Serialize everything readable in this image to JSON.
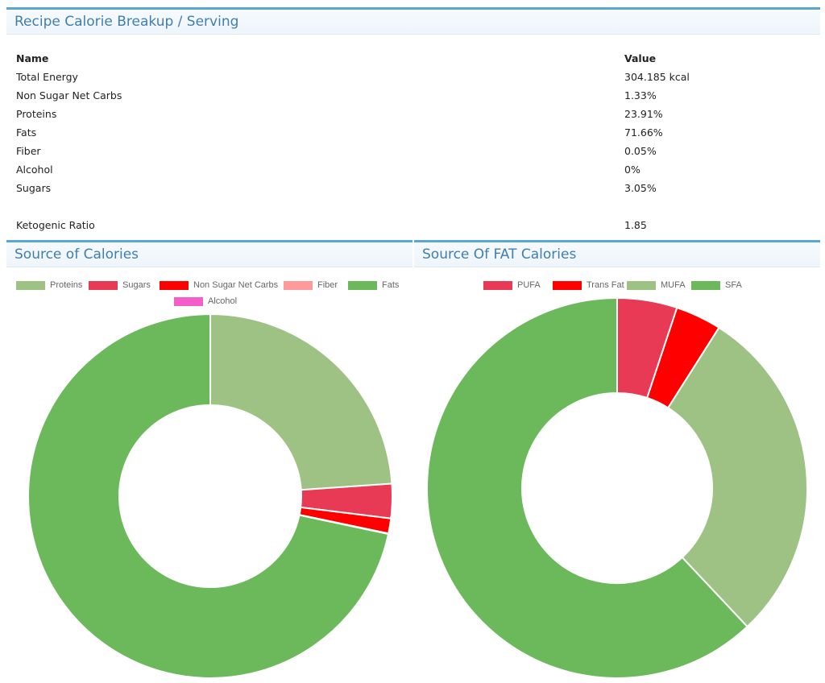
{
  "breakup": {
    "title": "Recipe Calorie Breakup / Serving",
    "headers": {
      "name": "Name",
      "value": "Value"
    },
    "rows": [
      {
        "name": "Total Energy",
        "value": "304.185 kcal"
      },
      {
        "name": "Non Sugar Net Carbs",
        "value": "1.33%"
      },
      {
        "name": "Proteins",
        "value": "23.91%"
      },
      {
        "name": "Fats",
        "value": "71.66%"
      },
      {
        "name": "Fiber",
        "value": "0.05%"
      },
      {
        "name": "Alcohol",
        "value": "0%"
      },
      {
        "name": "Sugars",
        "value": "3.05%"
      }
    ],
    "keto": {
      "name": "Ketogenic Ratio",
      "value": "1.85"
    }
  },
  "chart_data": [
    {
      "type": "pie",
      "donut": true,
      "title": "Source of Calories",
      "legend": "top",
      "labels": [
        "Proteins",
        "Sugars",
        "Non Sugar Net Carbs",
        "Fiber",
        "Fats",
        "Alcohol"
      ],
      "values": [
        23.91,
        3.05,
        1.33,
        0.05,
        71.66,
        0
      ],
      "colors": [
        "#9dc284",
        "#e83a55",
        "#ff0000",
        "#ff9a9a",
        "#6bb95a",
        "#f55ec8"
      ]
    },
    {
      "type": "pie",
      "donut": true,
      "title": "Source Of FAT Calories",
      "legend": "top",
      "labels": [
        "PUFA",
        "Trans Fat",
        "MUFA",
        "SFA"
      ],
      "values": [
        5.1,
        3.9,
        29.0,
        62.0
      ],
      "colors": [
        "#e83a55",
        "#ff0000",
        "#9dc284",
        "#6bb95a"
      ]
    }
  ]
}
